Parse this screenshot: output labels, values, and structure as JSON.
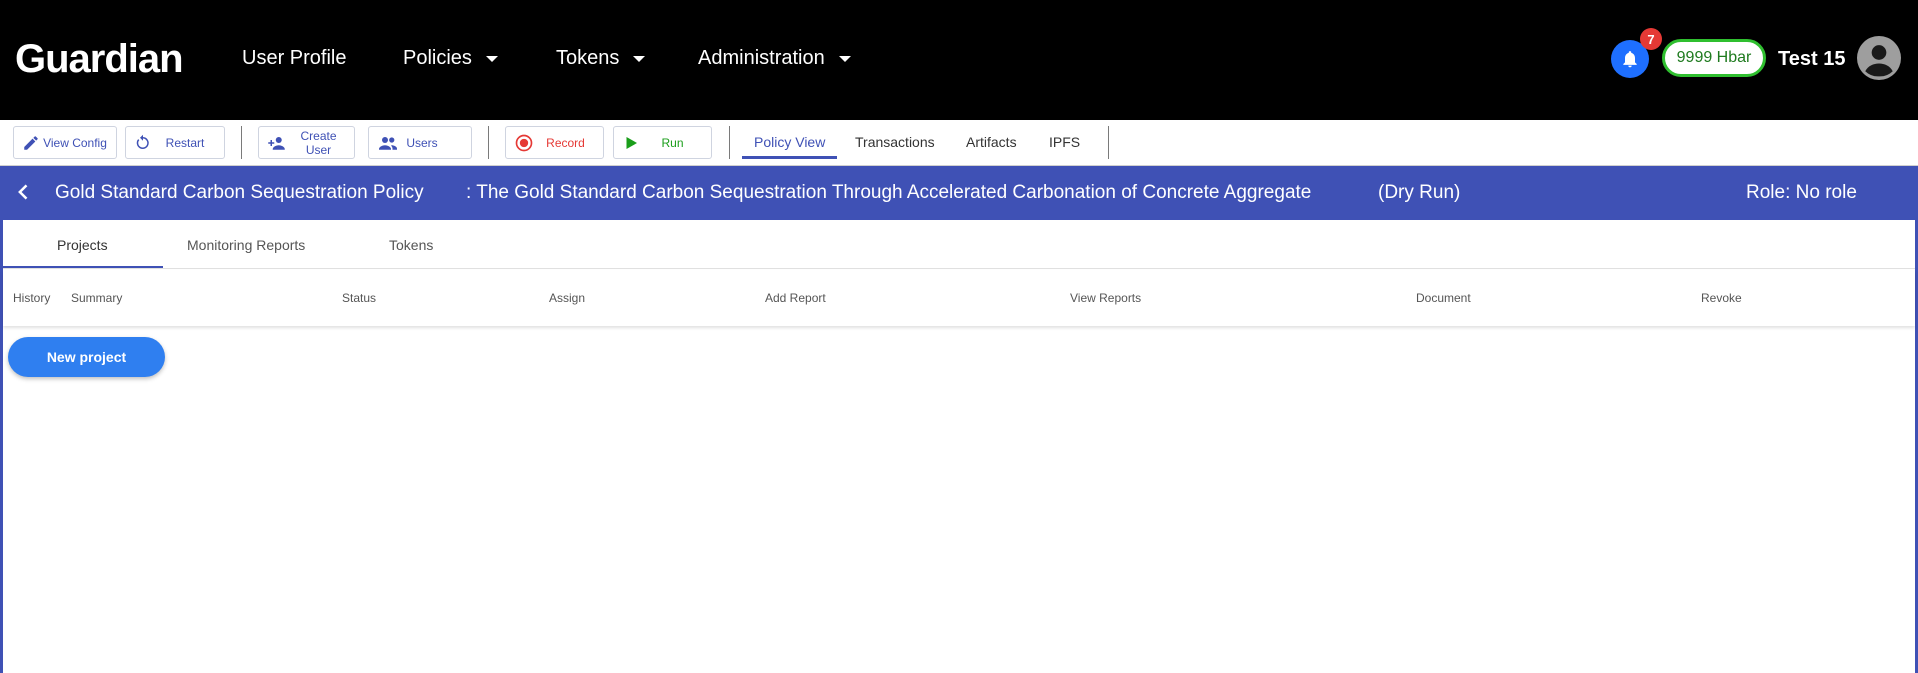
{
  "header": {
    "logo": "Guardian",
    "nav": [
      {
        "label": "User Profile"
      },
      {
        "label": "Policies"
      },
      {
        "label": "Tokens"
      },
      {
        "label": "Administration"
      }
    ],
    "notifications_count": "7",
    "balance": "9999 Hbar",
    "username": "Test 15"
  },
  "toolbar": {
    "view_config": "View Config",
    "restart": "Restart",
    "create_user": "Create User",
    "users": "Users",
    "record": "Record",
    "run": "Run",
    "tabs": [
      {
        "label": "Policy View",
        "active": true
      },
      {
        "label": "Transactions"
      },
      {
        "label": "Artifacts"
      },
      {
        "label": "IPFS"
      }
    ]
  },
  "policy": {
    "name": "Gold Standard Carbon Sequestration Policy",
    "description": ": The Gold Standard Carbon Sequestration Through Accelerated Carbonation of Concrete Aggregate",
    "mode": "(Dry Run)",
    "role": "Role: No role"
  },
  "content": {
    "tabs": [
      {
        "label": "Projects",
        "active": true
      },
      {
        "label": "Monitoring Reports"
      },
      {
        "label": "Tokens"
      }
    ],
    "columns": [
      "History",
      "Summary",
      "Status",
      "Assign",
      "Add Report",
      "View Reports",
      "Document",
      "Revoke"
    ],
    "new_project": "New project"
  },
  "colors": {
    "header_bg": "#000000",
    "accent": "#3f51b5",
    "bell": "#1e6fff",
    "badge": "#e53935",
    "hbar_border": "#2fbf2f",
    "record": "#e53935",
    "run": "#1a9e1a",
    "primary_button": "#2f7ff0"
  }
}
